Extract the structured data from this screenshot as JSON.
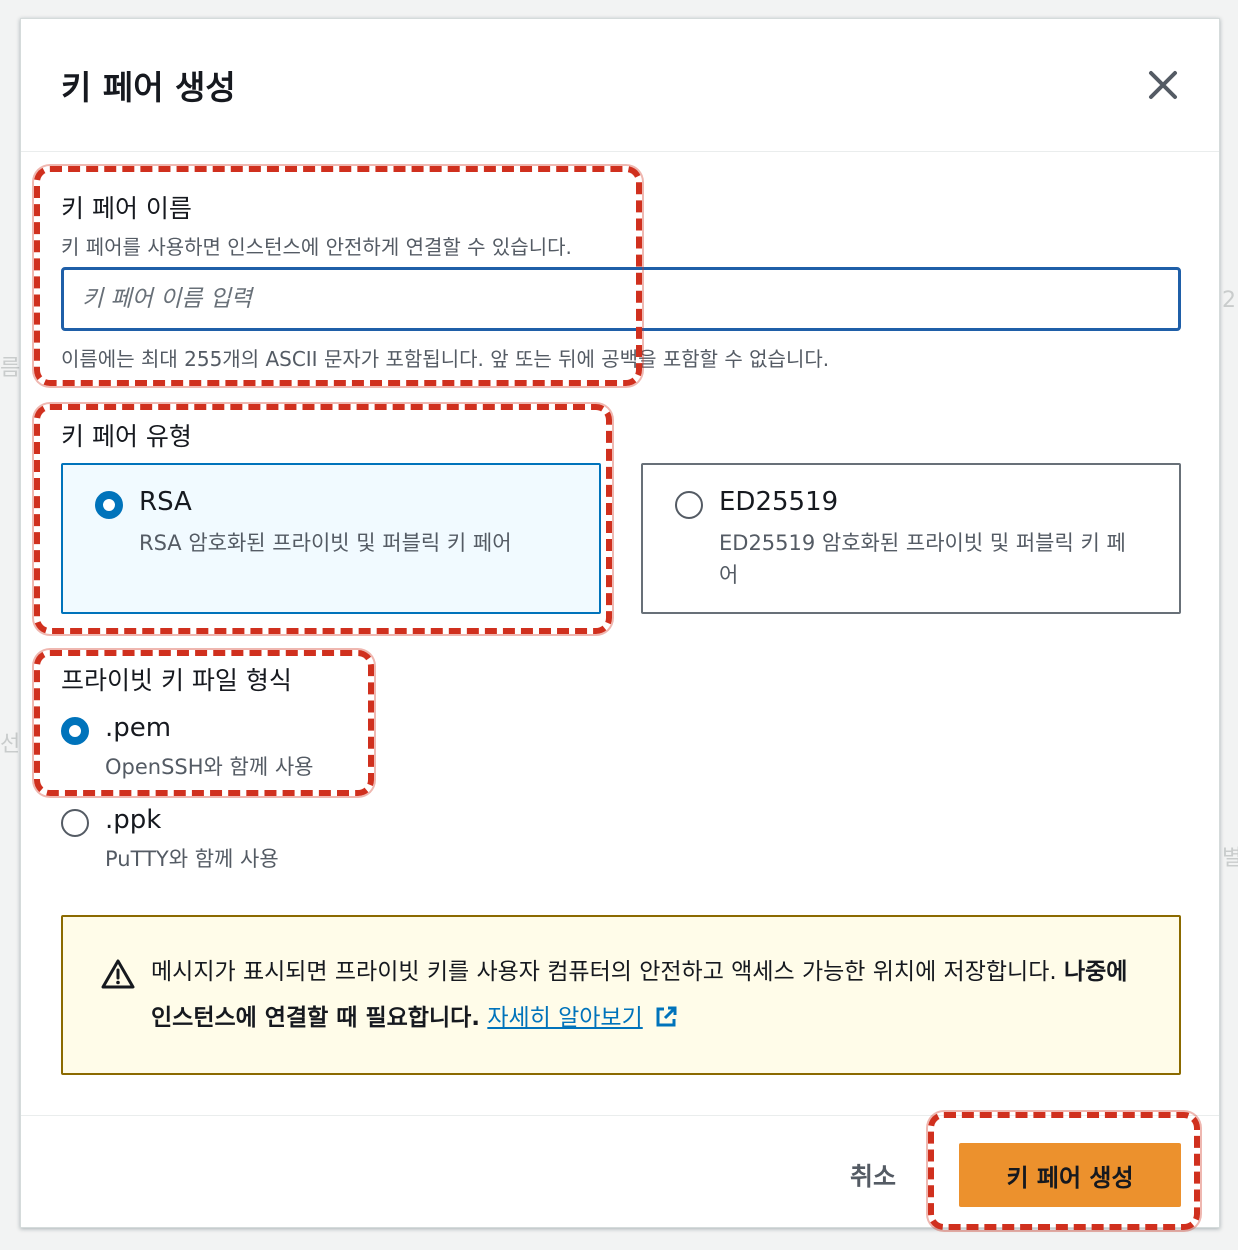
{
  "dialog": {
    "title": "키 페어 생성"
  },
  "name_section": {
    "label": "키 페어 이름",
    "description": "키 페어를 사용하면 인스턴스에 안전하게 연결할 수 있습니다.",
    "input_value": "",
    "input_placeholder": "키 페어 이름 입력",
    "constraint": "이름에는 최대 255개의 ASCII 문자가 포함됩니다. 앞 또는 뒤에 공백을 포함할 수 없습니다."
  },
  "type_section": {
    "label": "키 페어 유형",
    "options": [
      {
        "title": "RSA",
        "description": "RSA 암호화된 프라이빗 및 퍼블릭 키 페어",
        "selected": true
      },
      {
        "title": "ED25519",
        "description": "ED25519 암호화된 프라이빗 및 퍼블릭 키 페어",
        "selected": false
      }
    ]
  },
  "format_section": {
    "label": "프라이빗 키 파일 형식",
    "options": [
      {
        "title": ".pem",
        "description": "OpenSSH와 함께 사용",
        "selected": true
      },
      {
        "title": ".ppk",
        "description": "PuTTY와 함께 사용",
        "selected": false
      }
    ]
  },
  "alert": {
    "icon": "warning-icon",
    "text_plain": "메시지가 표시되면 프라이빗 키를 사용자 컴퓨터의 안전하고 액세스 가능한 위치에 저장합니다.",
    "text_bold": "나중에 인스턴스에 연결할 때 필요합니다.",
    "link_text": "자세히 알아보기",
    "link_icon": "external-link-icon"
  },
  "footer": {
    "cancel_label": "취소",
    "create_label": "키 페어 생성"
  },
  "colors": {
    "primary_button": "#ec912d",
    "selected_accent": "#0073bb",
    "annotation": "#d0301e",
    "alert_background": "#fffce9"
  }
}
